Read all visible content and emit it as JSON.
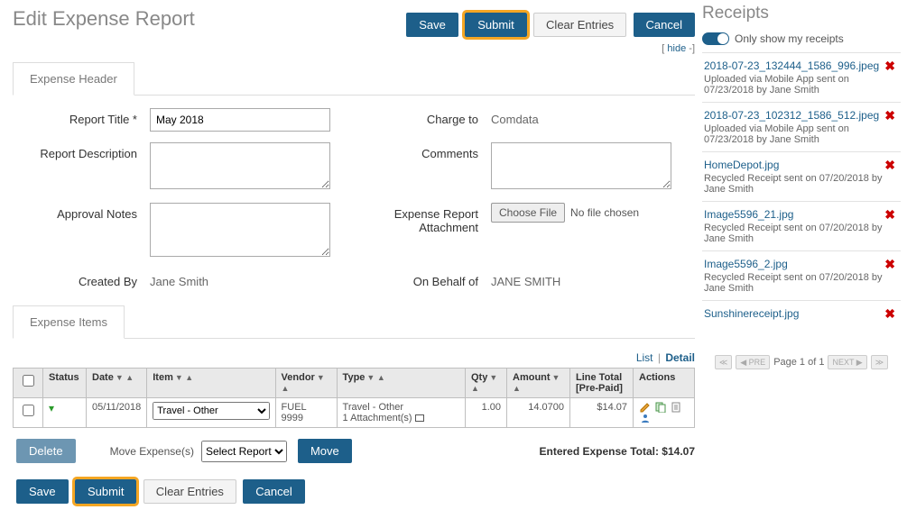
{
  "page_title": "Edit Expense Report",
  "top_buttons": {
    "save": "Save",
    "submit": "Submit",
    "clear": "Clear Entries",
    "cancel": "Cancel"
  },
  "hide_text": "hide",
  "tab_header": "Expense Header",
  "form": {
    "report_title_label": "Report Title *",
    "report_title_value": "May 2018",
    "description_label": "Report Description",
    "description_value": "",
    "approval_notes_label": "Approval Notes",
    "approval_notes_value": "",
    "created_by_label": "Created By",
    "created_by_value": "Jane Smith",
    "charge_to_label": "Charge to",
    "charge_to_value": "Comdata",
    "comments_label": "Comments",
    "comments_value": "",
    "attachment_label": "Expense Report Attachment",
    "choose_file_btn": "Choose File",
    "no_file_text": "No file chosen",
    "on_behalf_label": "On Behalf of",
    "on_behalf_value": "JANE SMITH"
  },
  "tab_items": "Expense Items",
  "list_label": "List",
  "detail_label": "Detail",
  "table": {
    "col_status": "Status",
    "col_date": "Date",
    "col_item": "Item",
    "col_vendor": "Vendor",
    "col_type": "Type",
    "col_qty": "Qty",
    "col_amount": "Amount",
    "col_linetotal1": "Line Total",
    "col_linetotal2": "[Pre-Paid]",
    "col_actions": "Actions",
    "rows": [
      {
        "date": "05/11/2018",
        "item": "Travel - Other",
        "vendor": "FUEL 9999",
        "type_line1": "Travel - Other",
        "type_line2": "1 Attachment(s)",
        "qty": "1.00",
        "amount": "14.0700",
        "line_total": "$14.07"
      }
    ]
  },
  "delete_btn": "Delete",
  "move_label": "Move Expense(s)",
  "move_select": "Select Report",
  "move_btn": "Move",
  "entered_total_label": "Entered Expense Total: ",
  "entered_total_value": "$14.07",
  "receipts_title": "Receipts",
  "only_my": "Only show my receipts",
  "receipts": [
    {
      "name": "2018-07-23_132444_1586_996.jpeg",
      "meta": "Uploaded via Mobile App sent on 07/23/2018 by Jane Smith"
    },
    {
      "name": "2018-07-23_102312_1586_512.jpeg",
      "meta": "Uploaded via Mobile App sent on 07/23/2018 by Jane Smith"
    },
    {
      "name": "HomeDepot.jpg",
      "meta": "Recycled Receipt sent on 07/20/2018 by Jane Smith"
    },
    {
      "name": "Image5596_21.jpg",
      "meta": "Recycled Receipt sent on 07/20/2018 by Jane Smith"
    },
    {
      "name": "Image5596_2.jpg",
      "meta": "Recycled Receipt sent on 07/20/2018 by Jane Smith"
    },
    {
      "name": "Sunshinereceipt.jpg",
      "meta": ""
    }
  ],
  "pager_text": "Page 1 of 1",
  "pager": {
    "first": "≪",
    "prev": "◀ PRE",
    "next": "NEXT ▶",
    "last": "≫"
  }
}
